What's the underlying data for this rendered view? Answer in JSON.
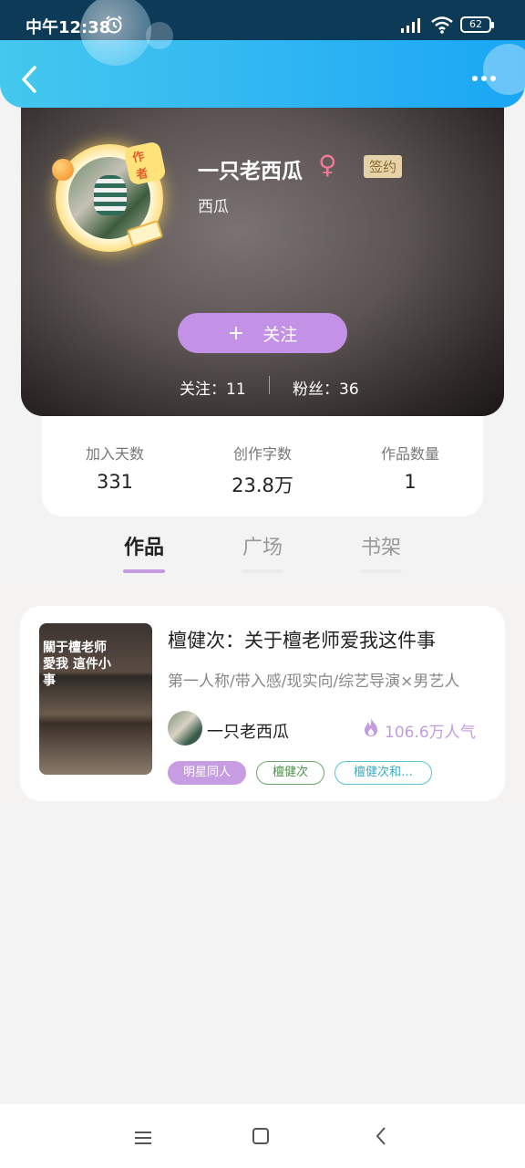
{
  "status_bar": {
    "time": "中午12:38",
    "battery": "62"
  },
  "profile": {
    "avatar_tag": "作者",
    "name": "一只老西瓜",
    "gender_symbol": "♀",
    "badge": "签约",
    "sub_name": "西瓜",
    "follow_plus": "+",
    "follow_label": "关注",
    "following": "关注：11",
    "fans": "粉丝：36"
  },
  "stats": [
    {
      "label": "加入天数",
      "value": "331"
    },
    {
      "label": "创作字数",
      "value": "23.8万"
    },
    {
      "label": "作品数量",
      "value": "1"
    }
  ],
  "tabs": [
    {
      "label": "作品",
      "active": true
    },
    {
      "label": "广场",
      "active": false
    },
    {
      "label": "书架",
      "active": false
    }
  ],
  "book": {
    "cover_text": "關于檀老师 愛我 這件小事",
    "title": "檀健次：关于檀老师爱我这件事",
    "tags_line": "第一人称/带入感/现实向/综艺导演×男艺人",
    "author": "一只老西瓜",
    "popularity": "106.6万人气",
    "tags": [
      "明星同人",
      "檀健次",
      "檀健次和…"
    ]
  },
  "colors": {
    "accent": "#c391e6",
    "header_blue": "#2fb5f2"
  },
  "icons": [
    "back-icon",
    "more-icon",
    "alarm-icon",
    "signal-icon",
    "wifi-icon",
    "fire-icon",
    "menu-icon",
    "home-icon",
    "nav-back-icon"
  ]
}
